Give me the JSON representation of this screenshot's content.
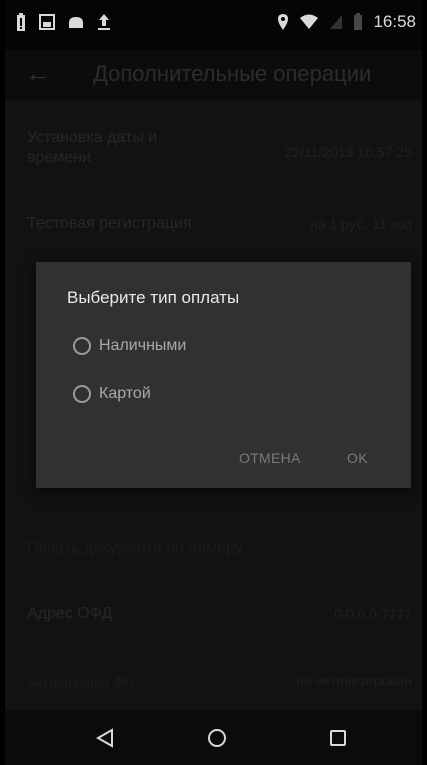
{
  "status_bar": {
    "left_icons": [
      "battery-saver-icon",
      "image-icon",
      "cloud-icon",
      "upload-icon"
    ],
    "right_icons": [
      "location-icon",
      "wifi-icon",
      "signal-icon",
      "battery-icon"
    ],
    "time": "16:58"
  },
  "app_bar": {
    "back_icon": "arrow-left-icon",
    "title": "Дополнительные операции"
  },
  "list": {
    "items": [
      {
        "label": "Установка даты и\nвремени",
        "value": "22/11/2019 16:57:25"
      },
      {
        "label": "Тестовая регистрация",
        "value": "на 1 руб. 11 коп"
      },
      {
        "label": "Печать документа по номеру",
        "value": ""
      },
      {
        "label": "Адрес ОФД",
        "value": "0.0.0.0:7777"
      },
      {
        "label": "Активизация ФН",
        "value": "не активизирован"
      }
    ]
  },
  "dialog": {
    "title": "Выберите тип оплаты",
    "options": [
      "Наличными",
      "Картой"
    ],
    "cancel_label": "ОТМЕНА",
    "ok_label": "OK"
  },
  "nav_bar": {
    "icons": [
      "back-triangle-icon",
      "home-circle-icon",
      "recents-square-icon"
    ]
  },
  "colors": {
    "background": "#161616",
    "dialog": "#313131",
    "dialog_text": "#eaeaea"
  }
}
